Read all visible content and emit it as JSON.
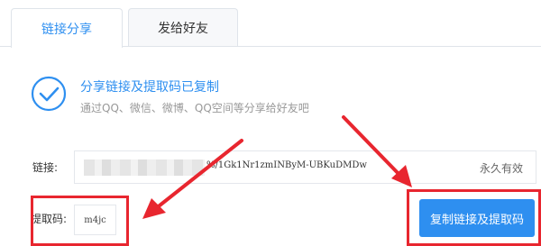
{
  "tabs": [
    {
      "label": "链接分享",
      "active": true
    },
    {
      "label": "发给好友",
      "active": false
    }
  ],
  "success": {
    "title": "分享链接及提取码已复制",
    "subtitle": "通过QQ、微信、微博、QQ空间等分享给好友吧",
    "icon": "check-circle-icon"
  },
  "link": {
    "label": "链接:",
    "value": "%/1Gk1Nr1zmINByM-UBKuDMDw",
    "validity": "永久有效"
  },
  "code": {
    "label": "提取码:",
    "value": "m4jc"
  },
  "copy_button": {
    "label": "复制链接及提取码"
  },
  "colors": {
    "accent": "#2e8ff0",
    "annotation": "#e8262f"
  }
}
